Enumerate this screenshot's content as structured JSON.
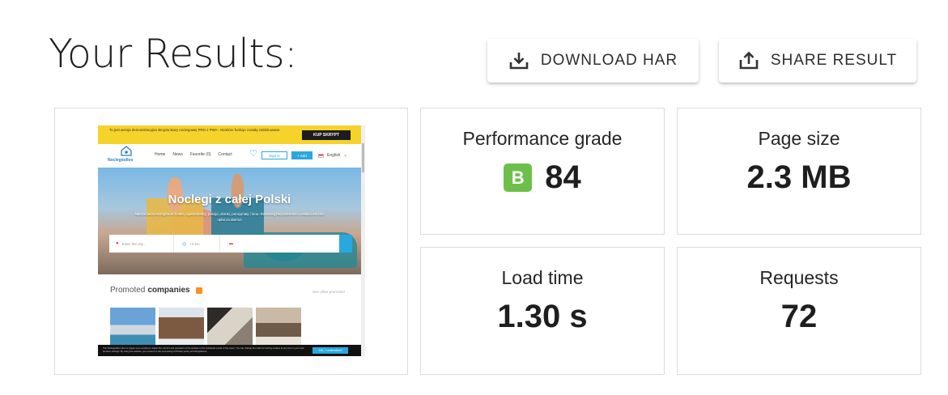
{
  "header": {
    "title": "Your Results:",
    "download_label": "DOWNLOAD HAR",
    "share_label": "SHARE RESULT"
  },
  "metrics": {
    "performance": {
      "label": "Performance grade",
      "grade": "B",
      "value": "84",
      "grade_color": "#6cc04a"
    },
    "page_size": {
      "label": "Page size",
      "value": "2.3 MB"
    },
    "load_time": {
      "label": "Load time",
      "value": "1.30 s"
    },
    "requests": {
      "label": "Requests",
      "value": "72"
    }
  },
  "screenshot": {
    "topbar_text": "To jest wersja demonstracyjna skryptu Bazy noclegowej PRO z PWA - Niektóre funkcje zostały zablokowane.",
    "buy_label": "KUP SKRYPT",
    "logo_text": "Noclegiodlos",
    "nav_links": [
      "Home",
      "News",
      "Favorite (0)",
      "Contact"
    ],
    "signin_label": "Sign in",
    "add_label": "+ Add",
    "language": "English",
    "hero_title": "Noclegi z całej Polski",
    "hero_subtitle": "Nasza baza noclegów to hotele, apartamenty, pokoje, domki, pensjonaty i inne. Rezerwuj bezpośrednio u właścicieli bez opłat za darmo!",
    "search_city_placeholder": "Enter the city...",
    "search_distance": "+0 km",
    "promoted_label": "Promoted",
    "promoted_bold": "companies",
    "see_all": "See other promoted",
    "cookie_text": "The Noclegiodlos sites or pages uses cookies to adjust the content and operation of the website to the individual needs of the users. You can change the rules for storing cookies at any time in your web browser settings. By using the website, you consent to the processing of Privacy policy and Regulations.",
    "cookie_ok": "OK, I understand"
  },
  "colors": {
    "accent": "#2aa7df",
    "topbar": "#f5d32a"
  }
}
